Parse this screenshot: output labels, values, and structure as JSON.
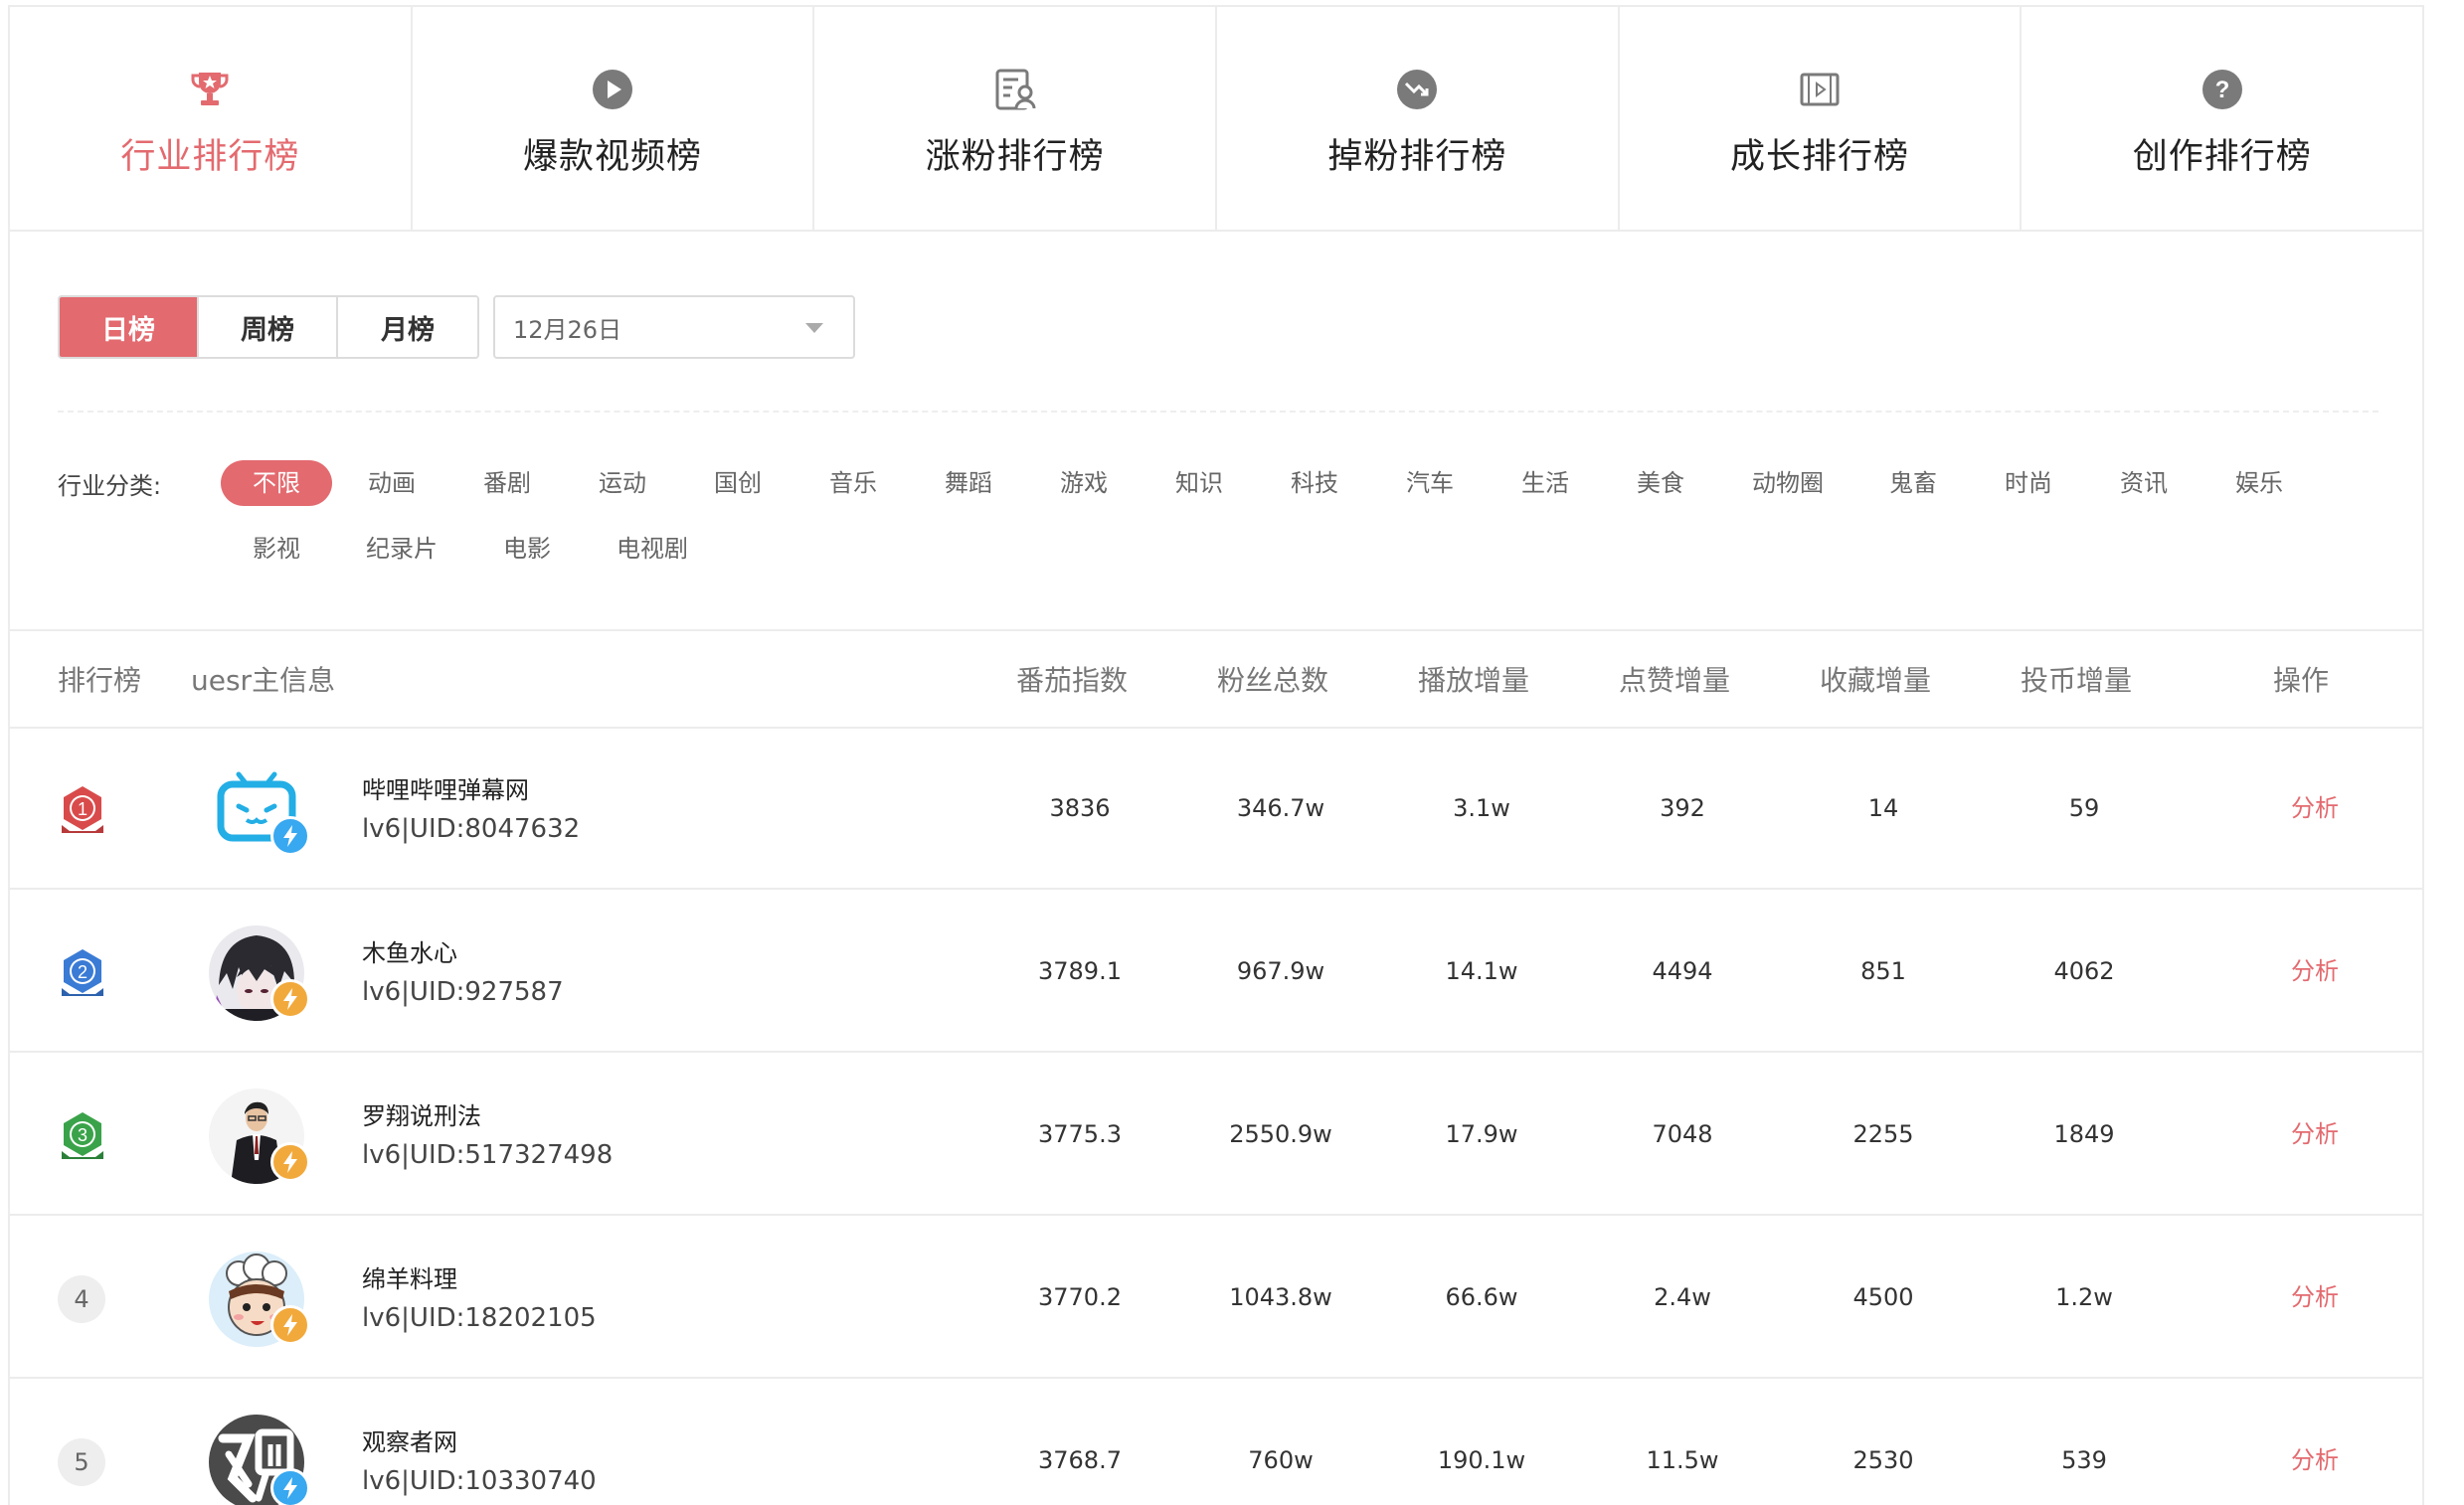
{
  "tabs": [
    {
      "label": "行业排行榜",
      "icon": "trophy-icon",
      "active": true
    },
    {
      "label": "爆款视频榜",
      "icon": "play-icon",
      "active": false
    },
    {
      "label": "涨粉排行榜",
      "icon": "user-list-icon",
      "active": false
    },
    {
      "label": "掉粉排行榜",
      "icon": "trend-down-icon",
      "active": false
    },
    {
      "label": "成长排行榜",
      "icon": "film-icon",
      "active": false
    },
    {
      "label": "创作排行榜",
      "icon": "question-icon",
      "active": false
    }
  ],
  "period": {
    "options": [
      "日榜",
      "周榜",
      "月榜"
    ],
    "selected": "日榜"
  },
  "date": {
    "value": "12月26日"
  },
  "category": {
    "label": "行业分类:",
    "selected": "不限",
    "items": [
      "不限",
      "动画",
      "番剧",
      "运动",
      "国创",
      "音乐",
      "舞蹈",
      "游戏",
      "知识",
      "科技",
      "汽车",
      "生活",
      "美食",
      "动物圈",
      "鬼畜",
      "时尚",
      "资讯",
      "娱乐",
      "影视",
      "纪录片",
      "电影",
      "电视剧"
    ]
  },
  "table": {
    "headers": {
      "rank": "排行榜",
      "user": "uesr主信息",
      "index": "番茄指数",
      "fans": "粉丝总数",
      "plays": "播放增量",
      "likes": "点赞增量",
      "favs": "收藏增量",
      "coins": "投币增量",
      "action": "操作"
    },
    "rows": [
      {
        "rank": "1",
        "name": "哔哩哔哩弹幕网",
        "uid": "lv6|UID:8047632",
        "index": "3836",
        "fans": "346.7w",
        "plays": "3.1w",
        "likes": "392",
        "favs": "14",
        "coins": "59",
        "action": "分析"
      },
      {
        "rank": "2",
        "name": "木鱼水心",
        "uid": "lv6|UID:927587",
        "index": "3789.1",
        "fans": "967.9w",
        "plays": "14.1w",
        "likes": "4494",
        "favs": "851",
        "coins": "4062",
        "action": "分析"
      },
      {
        "rank": "3",
        "name": "罗翔说刑法",
        "uid": "lv6|UID:517327498",
        "index": "3775.3",
        "fans": "2550.9w",
        "plays": "17.9w",
        "likes": "7048",
        "favs": "2255",
        "coins": "1849",
        "action": "分析"
      },
      {
        "rank": "4",
        "name": "绵羊料理",
        "uid": "lv6|UID:18202105",
        "index": "3770.2",
        "fans": "1043.8w",
        "plays": "66.6w",
        "likes": "2.4w",
        "favs": "4500",
        "coins": "1.2w",
        "action": "分析"
      },
      {
        "rank": "5",
        "name": "观察者网",
        "uid": "lv6|UID:10330740",
        "index": "3768.7",
        "fans": "760w",
        "plays": "190.1w",
        "likes": "11.5w",
        "favs": "2530",
        "coins": "539",
        "action": "分析"
      }
    ]
  },
  "colors": {
    "accent": "#e36a6f",
    "gold-badge": "#d94b4b",
    "silver-badge": "#3a7bd5",
    "bronze-badge": "#3aa34a",
    "bolt-blue": "#38a8f0",
    "bolt-orange": "#f2a93b"
  }
}
